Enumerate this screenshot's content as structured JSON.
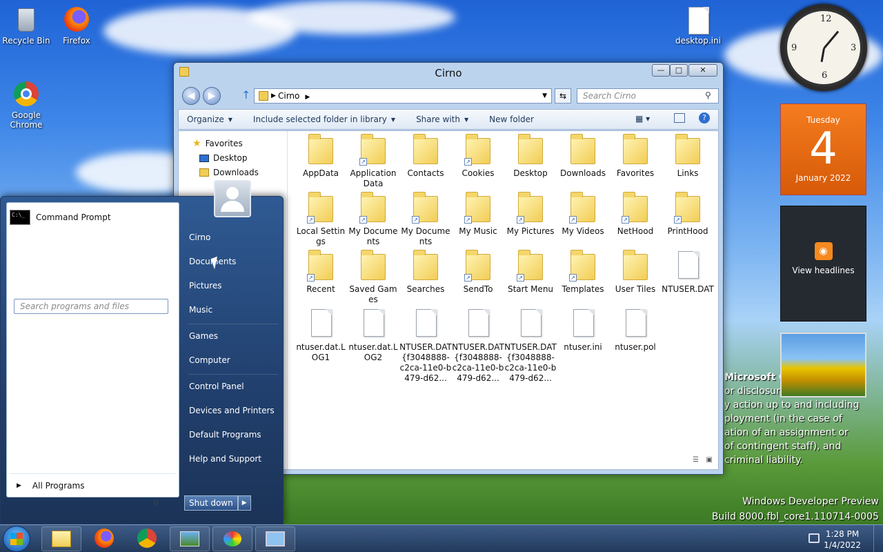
{
  "desktop": {
    "icons": [
      {
        "label": "Recycle Bin",
        "icon": "recycle-bin-icon"
      },
      {
        "label": "Firefox",
        "icon": "firefox-icon"
      },
      {
        "label": "Google Chrome",
        "icon": "chrome-icon"
      },
      {
        "label": "desktop.ini",
        "icon": "ini-file-icon"
      }
    ]
  },
  "explorer": {
    "title": "Cirno",
    "address": "Cirno",
    "search_placeholder": "Search Cirno",
    "commands": {
      "organize": "Organize",
      "include": "Include selected folder in library",
      "share": "Share with",
      "new_folder": "New folder"
    },
    "nav": {
      "favorites": "Favorites",
      "desktop": "Desktop",
      "downloads": "Downloads"
    },
    "items": [
      {
        "name": "AppData",
        "type": "folder"
      },
      {
        "name": "Application Data",
        "type": "folder-shortcut"
      },
      {
        "name": "Contacts",
        "type": "folder"
      },
      {
        "name": "Cookies",
        "type": "folder-shortcut"
      },
      {
        "name": "Desktop",
        "type": "folder"
      },
      {
        "name": "Downloads",
        "type": "folder"
      },
      {
        "name": "Favorites",
        "type": "folder"
      },
      {
        "name": "Links",
        "type": "folder"
      },
      {
        "name": "Local Settings",
        "type": "folder-shortcut"
      },
      {
        "name": "My Documents",
        "type": "folder-shortcut"
      },
      {
        "name": "My Documents",
        "type": "folder-shortcut"
      },
      {
        "name": "My Music",
        "type": "folder-shortcut"
      },
      {
        "name": "My Pictures",
        "type": "folder-shortcut"
      },
      {
        "name": "My Videos",
        "type": "folder-shortcut"
      },
      {
        "name": "NetHood",
        "type": "folder-shortcut"
      },
      {
        "name": "PrintHood",
        "type": "folder-shortcut"
      },
      {
        "name": "Recent",
        "type": "folder-shortcut"
      },
      {
        "name": "Saved Games",
        "type": "folder"
      },
      {
        "name": "Searches",
        "type": "folder"
      },
      {
        "name": "SendTo",
        "type": "folder-shortcut"
      },
      {
        "name": "Start Menu",
        "type": "folder-shortcut"
      },
      {
        "name": "Templates",
        "type": "folder-shortcut"
      },
      {
        "name": "User Tiles",
        "type": "folder"
      },
      {
        "name": "NTUSER.DAT",
        "type": "file"
      },
      {
        "name": "ntuser.dat.LOG1",
        "type": "file"
      },
      {
        "name": "ntuser.dat.LOG2",
        "type": "file"
      },
      {
        "name": "NTUSER.DAT{f3048888-c2ca-11e0-b479-d62...",
        "type": "file"
      },
      {
        "name": "NTUSER.DAT{f3048888-c2ca-11e0-b479-d62...",
        "type": "file"
      },
      {
        "name": "NTUSER.DAT{f3048888-c2ca-11e0-b479-d62...",
        "type": "file"
      },
      {
        "name": "ntuser.ini",
        "type": "ini"
      },
      {
        "name": "ntuser.pol",
        "type": "file"
      }
    ]
  },
  "start_menu": {
    "recent": "Command Prompt",
    "all_programs": "All Programs",
    "search_placeholder": "Search programs and files",
    "right": [
      "Cirno",
      "Documents",
      "Pictures",
      "Music",
      "Games",
      "Computer",
      "Control Panel",
      "Devices and Printers",
      "Default Programs",
      "Help and Support"
    ],
    "shutdown": "Shut down"
  },
  "gadgets": {
    "day": "Tuesday",
    "date": "4",
    "month_year": "January 2022",
    "rss": "View headlines"
  },
  "taskbar": {
    "time": "1:28 PM",
    "date": "1/4/2022"
  },
  "wallpaper_text": [
    "Microsoft Confidential",
    "or disclosure",
    "y action up to and including",
    "ployment (in the case of",
    "ation of an assignment or",
    "of contingent staff), and",
    "criminal liability."
  ],
  "watermark": [
    "Windows Developer Preview",
    "Build 8000.fbl_core1.110714-0005"
  ]
}
